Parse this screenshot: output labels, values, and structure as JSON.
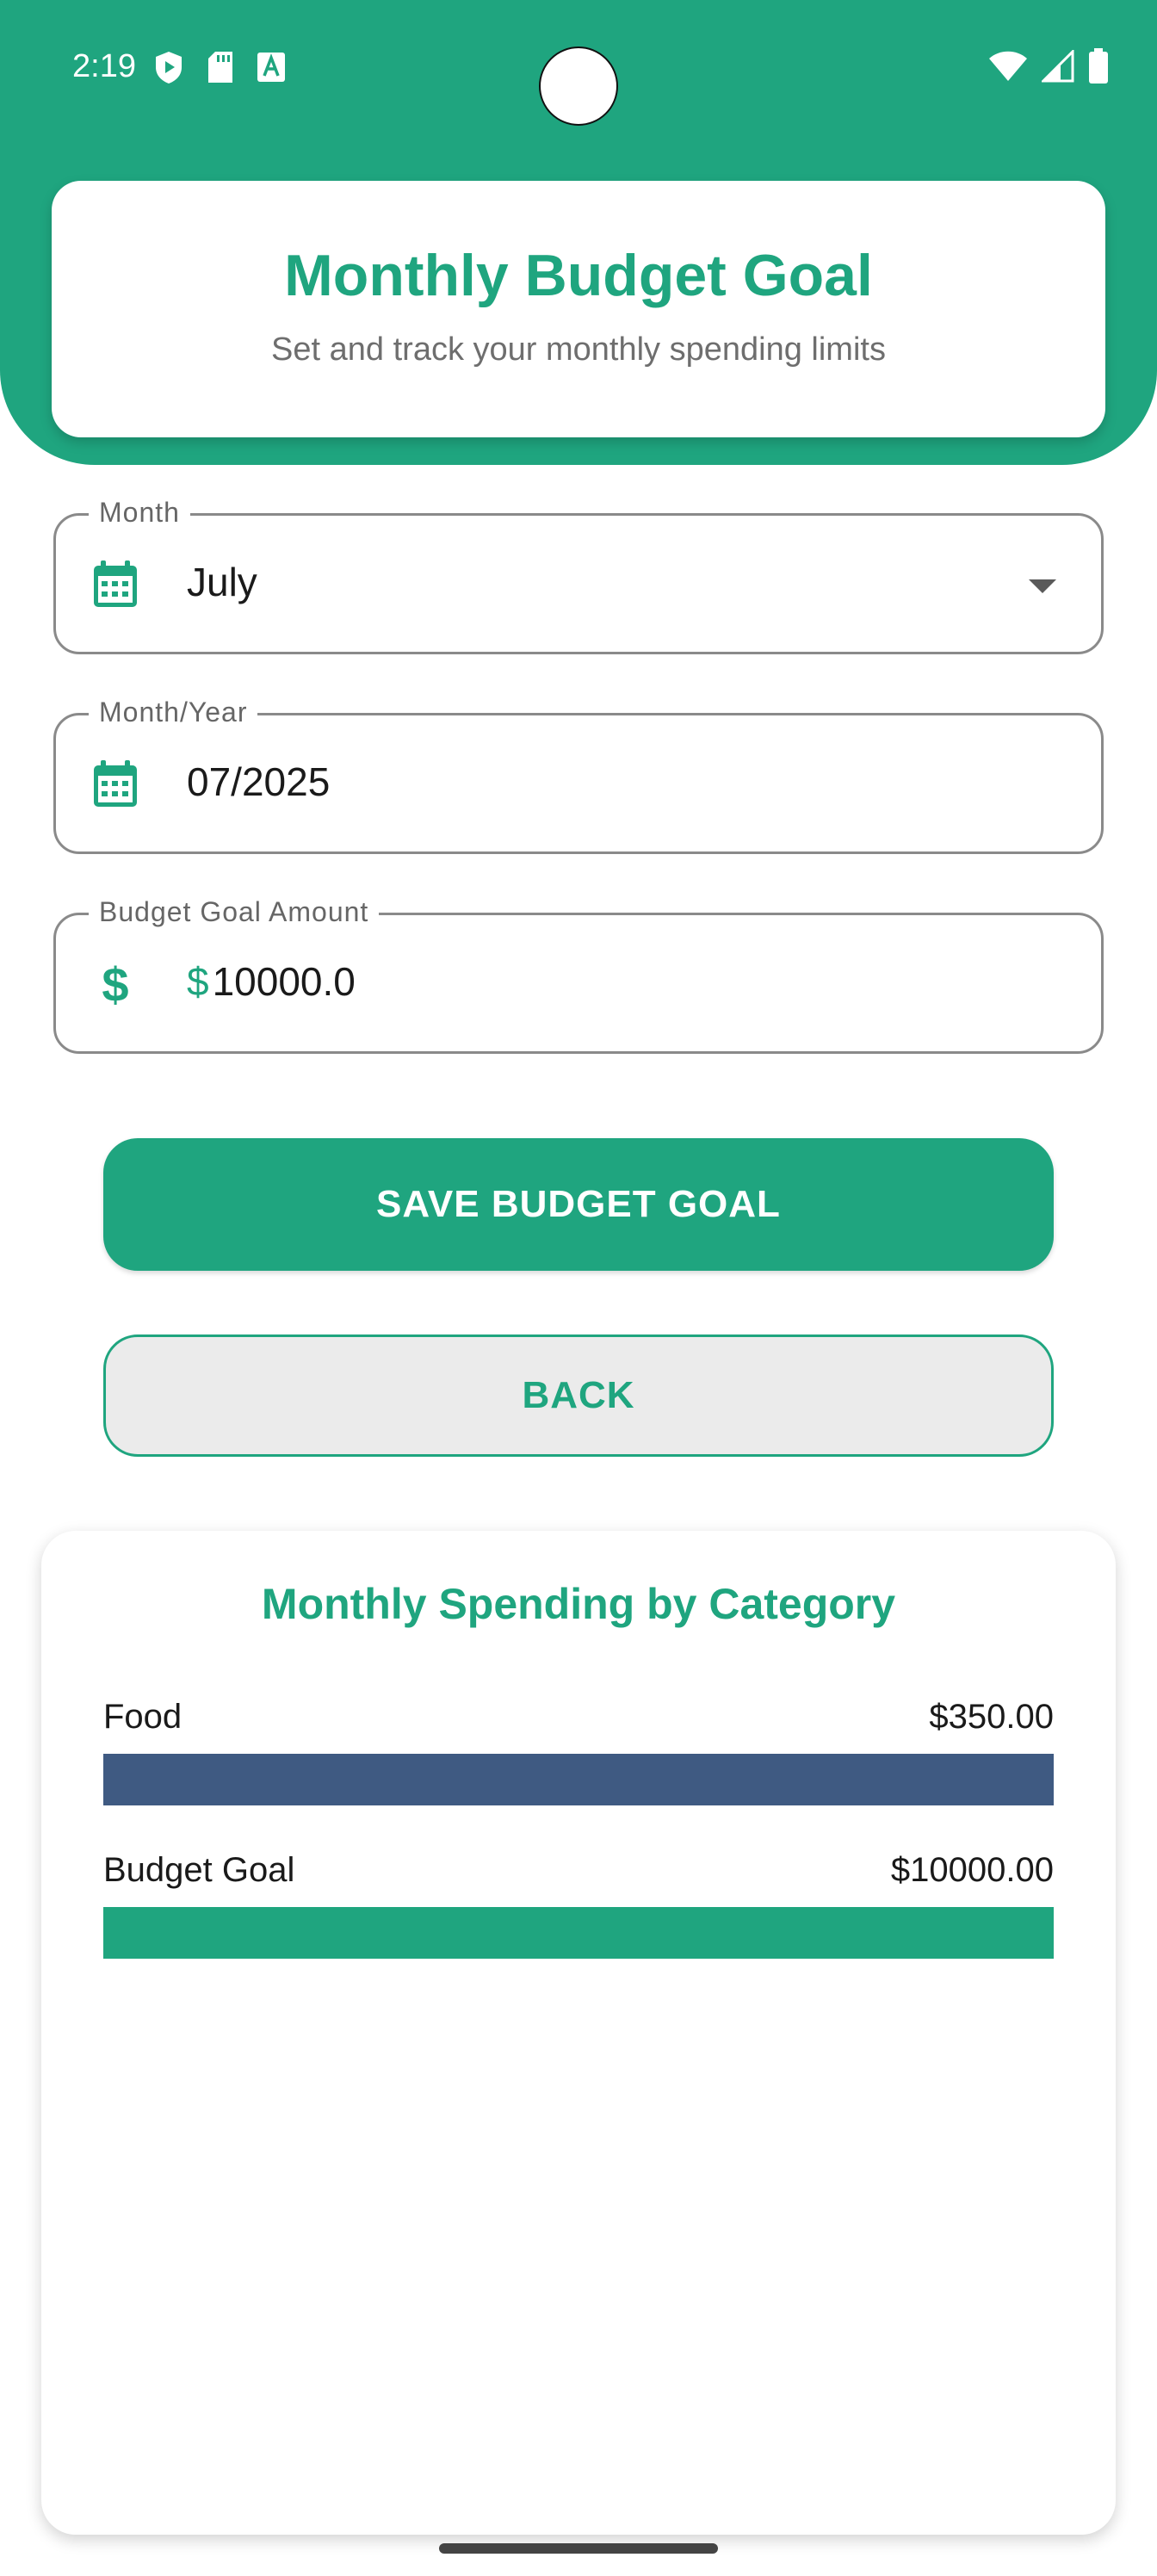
{
  "status_bar": {
    "time": "2:19",
    "icons": [
      "play-protect-icon",
      "sd-card-icon",
      "font-a-icon",
      "wifi-icon",
      "signal-icon",
      "battery-icon"
    ]
  },
  "header": {
    "title": "Monthly Budget Goal",
    "subtitle": "Set and track your monthly spending limits"
  },
  "form": {
    "month": {
      "label": "Month",
      "value": "July",
      "icon": "calendar-icon"
    },
    "month_year": {
      "label": "Month/Year",
      "value": "07/2025",
      "icon": "calendar-icon"
    },
    "amount": {
      "label": "Budget Goal Amount",
      "prefix": "$",
      "value": "10000.0",
      "icon": "dollar-icon"
    }
  },
  "buttons": {
    "save": "SAVE BUDGET GOAL",
    "back": "BACK"
  },
  "chart_data": {
    "type": "bar",
    "title": "Monthly Spending by Category",
    "categories": [
      "Food",
      "Budget Goal"
    ],
    "values": [
      350.0,
      10000.0
    ],
    "value_labels": [
      "$350.00",
      "$10000.00"
    ],
    "colors": [
      "#3f5a82",
      "#1fa57f"
    ]
  },
  "colors": {
    "primary": "#1fa57f",
    "food_bar": "#3f5a82",
    "back_button_bg": "#ebebeb"
  }
}
